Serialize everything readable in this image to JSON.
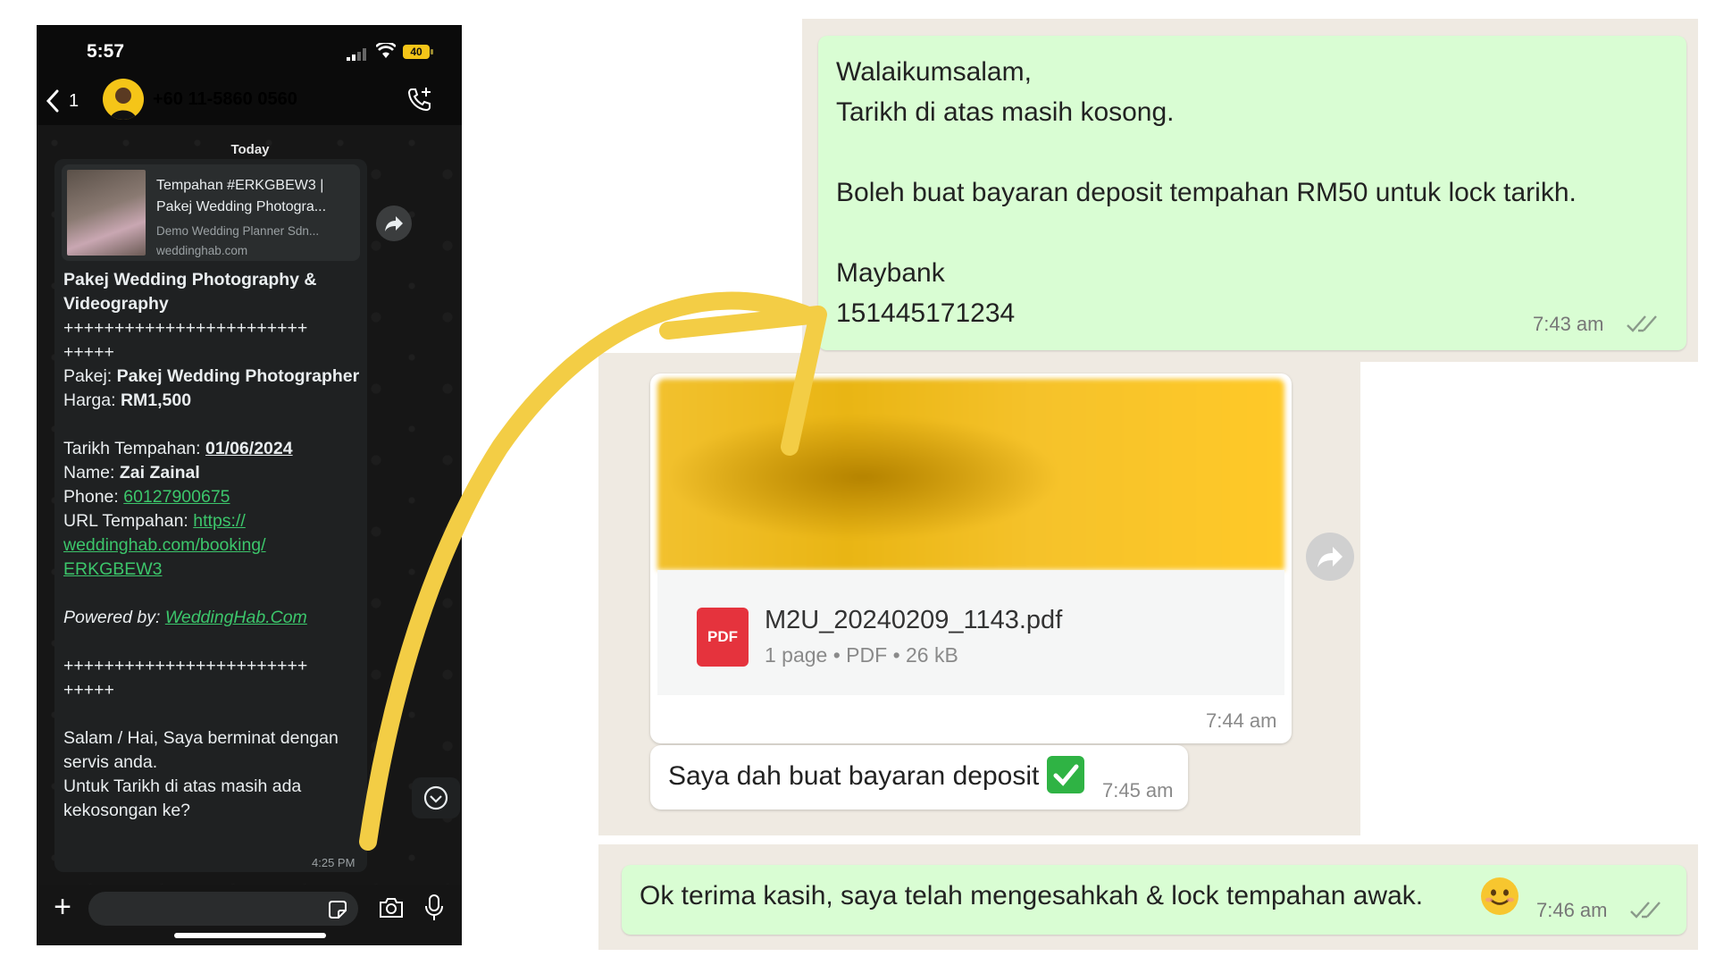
{
  "phone": {
    "status_time": "5:57",
    "battery": "40",
    "back_count": "1",
    "contact": "+60 11-5860 0560",
    "day_label": "Today",
    "preview": {
      "title": "Tempahan #ERKGBEW3 | Pakej Wedding Photogra...",
      "company": "Demo Wedding Planner Sdn...",
      "domain": "weddinghab.com"
    },
    "message": {
      "title": "Pakej Wedding Photography & Videography",
      "divider1": "++++++++++++++++++++++++\n+++++",
      "pakej_label": "Pakej: ",
      "pakej_value": "Pakej Wedding Photographer",
      "harga_label": "Harga: ",
      "harga_value": "RM1,500",
      "tarikh_label": "Tarikh Tempahan: ",
      "tarikh_value": "01/06/2024",
      "name_label": "Name: ",
      "name_value": "Zai Zainal",
      "phone_label": "Phone: ",
      "phone_value": "60127900675",
      "url_label": "URL Tempahan: ",
      "url_value": "https://\nweddinghab.com/booking/\nERKGBEW3",
      "powered_label": "Powered by: ",
      "powered_value": "WeddingHab.Com",
      "divider2": "++++++++++++++++++++++++\n+++++",
      "closing": "Salam / Hai, Saya berminat dengan servis anda.\nUntuk Tarikh di atas masih ada kekosongan ke?",
      "time": "4:25 PM"
    }
  },
  "reply1": {
    "text": "Walaikumsalam,\nTarikh di atas masih kosong.\n\nBoleh buat bayaran deposit tempahan RM50 untuk lock tarikh.\n\nMaybank\n151445171234",
    "time": "7:43 am"
  },
  "document": {
    "icon_label": "PDF",
    "filename": "M2U_20240209_1143.pdf",
    "meta": "1 page • PDF • 26 kB",
    "time": "7:44 am"
  },
  "incoming2": {
    "text": "Saya dah buat bayaran deposit",
    "time": "7:45 am"
  },
  "reply3": {
    "text": "Ok terima kasih, saya telah mengesahkah & lock tempahan awak.",
    "time": "7:46 am"
  },
  "colors": {
    "outgoing_bubble": "#d9fdd3",
    "link_green": "#3cc66b",
    "arrow_yellow": "#f3cd45",
    "pdf_red": "#e5333d"
  },
  "icons": [
    "back-chevron-icon",
    "wifi-icon",
    "signal-icon",
    "battery-icon",
    "call-add-icon",
    "forward-icon",
    "scroll-down-icon",
    "plus-icon",
    "sticker-icon",
    "camera-icon",
    "mic-icon",
    "pdf-icon",
    "check-emoji-icon",
    "smile-emoji-icon",
    "double-tick-icon"
  ]
}
